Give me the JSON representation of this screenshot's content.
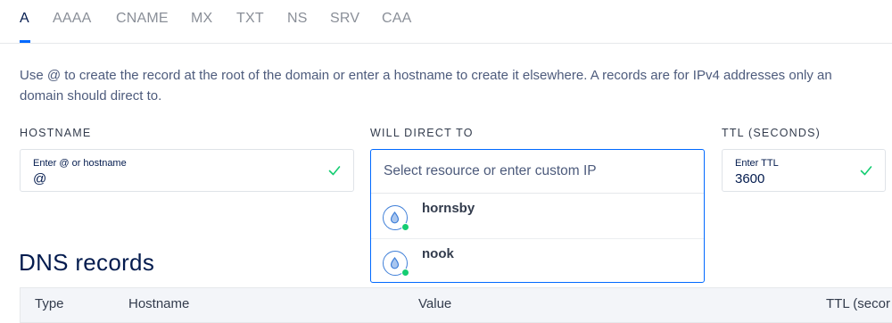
{
  "tabs": [
    {
      "label": "A",
      "active": true
    },
    {
      "label": "AAAA"
    },
    {
      "label": "CNAME"
    },
    {
      "label": "MX"
    },
    {
      "label": "TXT"
    },
    {
      "label": "NS"
    },
    {
      "label": "SRV"
    },
    {
      "label": "CAA"
    }
  ],
  "description": {
    "line1": "Use @ to create the record at the root of the domain or enter a hostname to create it elsewhere. A records are for IPv4 addresses only an",
    "line2": "domain should direct to."
  },
  "hostname": {
    "label": "HOSTNAME",
    "small_label": "Enter @ or hostname",
    "value": "@",
    "valid_icon": "check-icon"
  },
  "direct_to": {
    "label": "WILL DIRECT TO",
    "placeholder": "Select resource or enter custom IP",
    "options": [
      {
        "name": "hornsby",
        "icon": "droplet-icon",
        "status": "active"
      },
      {
        "name": "nook",
        "icon": "droplet-icon",
        "status": "active"
      }
    ]
  },
  "ttl": {
    "label": "TTL (SECONDS)",
    "small_label": "Enter TTL",
    "value": "3600",
    "valid_icon": "check-icon"
  },
  "dns_records": {
    "title": "DNS records",
    "columns": [
      "Type",
      "Hostname",
      "Value",
      "TTL (secor"
    ]
  },
  "colors": {
    "accent": "#0069ff",
    "valid": "#15cd72",
    "title": "#031b4e"
  }
}
